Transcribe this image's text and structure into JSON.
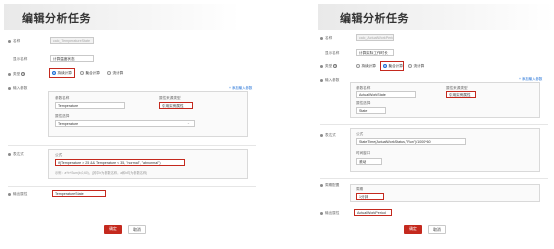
{
  "left": {
    "title": "编辑分析任务",
    "labels": {
      "name": "名称",
      "display_name": "显示名称",
      "type": "类型",
      "input_params": "输入参数",
      "expression": "表达式",
      "output_attr": "输出属性"
    },
    "name_value": "calc_TemperatureState",
    "display_name_value": "计算温度状态",
    "type_options": [
      "持续计算",
      "聚合计算",
      "流计算"
    ],
    "add_param_link": "+ 添加输入参数",
    "param_name_label": "参数名称",
    "param_name_value": "Temperature",
    "source_type_label": "属性来源类型",
    "source_type_value": "引用实例属性",
    "source_attr_label": "属性选择",
    "source_attr_value": "Temperature",
    "formula_label": "公式",
    "formula_value": "if(Temperature > 25 && Temperature < 35, \"normal\", \"abnormal\")",
    "formula_hint": "示例：a*b+Sum(b,0,60)，(其中b为参数名称，a和b均为参数名称)",
    "output_value": "TemperatureState",
    "confirm": "确定",
    "cancel": "取消"
  },
  "right": {
    "title": "编辑分析任务",
    "labels": {
      "name": "名称",
      "display_name": "显示名称",
      "type": "类型",
      "input_params": "输入参数",
      "expression": "表达式",
      "window": "周期配置",
      "output_attr": "输出属性"
    },
    "name_value": "calc_ActualWorkPeriod",
    "display_name_value": "计算实际工作时长",
    "type_options": [
      "持续计算",
      "聚合计算",
      "流计算"
    ],
    "add_param_link": "+ 添加输入参数",
    "param_name_label": "参数名称",
    "param_name_value": "ActualWorkState",
    "source_type_label": "属性来源类型",
    "source_type_value": "引用实例属性",
    "source_attr_label": "属性选择",
    "source_attr_value": "State",
    "formula_label": "公式",
    "formula_value": "StateTime(ActualWorkStatus,\"Run\")/1000*60",
    "agg_label": "时间窗口",
    "agg_value": "滚动",
    "period_label": "周期",
    "period_value": "1分钟",
    "output_value": "ActualWorkPeriod",
    "confirm": "确定",
    "cancel": "取消"
  }
}
